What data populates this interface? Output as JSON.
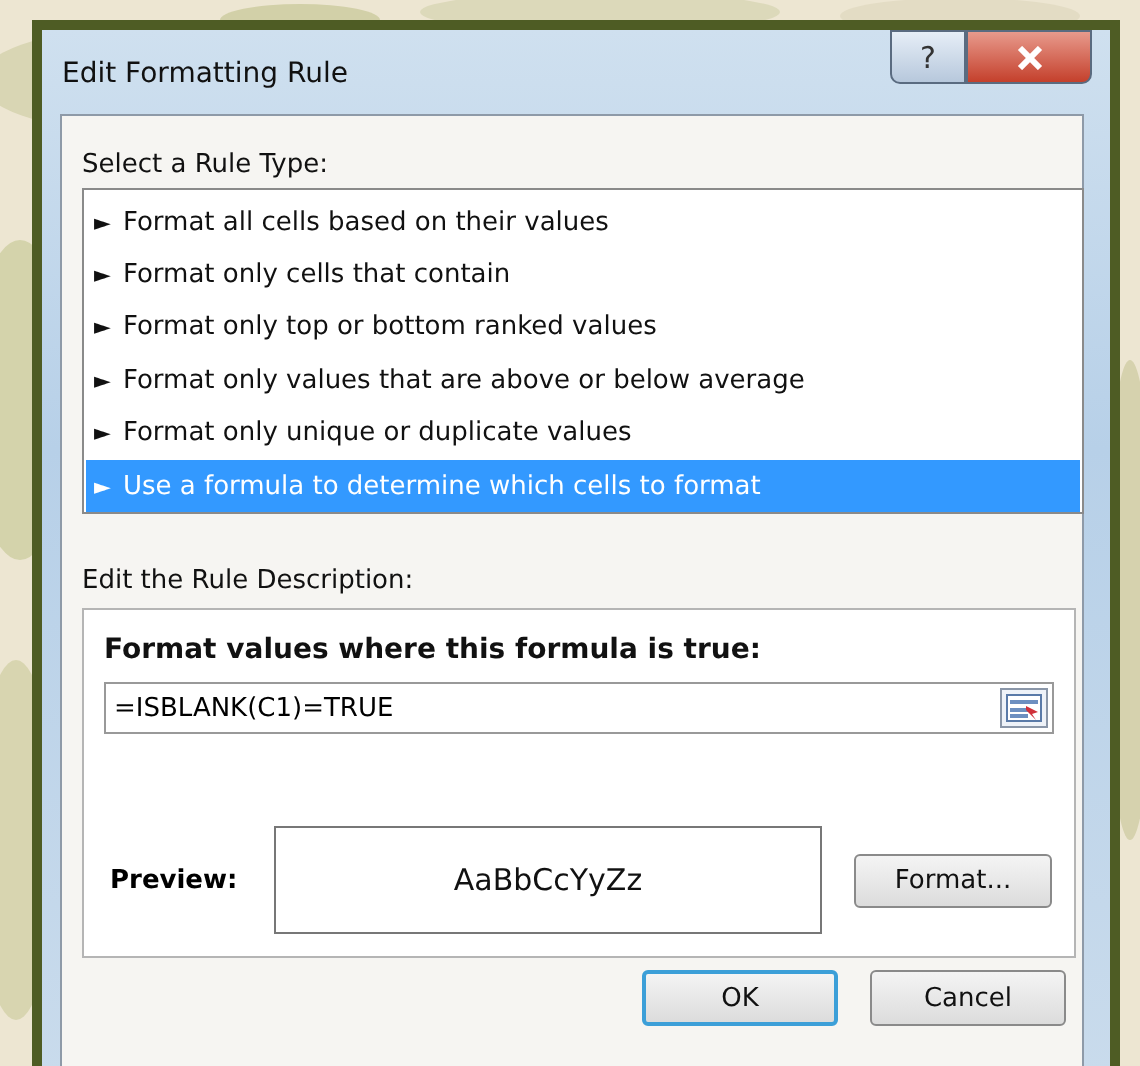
{
  "window": {
    "title": "Edit Formatting Rule",
    "help": "?"
  },
  "rule_type": {
    "label": "Select a Rule Type:",
    "items": [
      {
        "bullet": "►",
        "label": "Format all cells based on their values",
        "selected": false
      },
      {
        "bullet": "►",
        "label": "Format only cells that contain",
        "selected": false
      },
      {
        "bullet": "►",
        "label": "Format only top or bottom ranked values",
        "selected": false
      },
      {
        "bullet": "►",
        "label": "Format only values that are above or below average",
        "selected": false
      },
      {
        "bullet": "►",
        "label": "Format only unique or duplicate values",
        "selected": false
      },
      {
        "bullet": "►",
        "label": "Use a formula to determine which cells to format",
        "selected": true
      }
    ]
  },
  "description": {
    "label": "Edit the Rule Description:",
    "heading": "Format values where this formula is true:",
    "formula": "=ISBLANK(C1)=TRUE",
    "preview_label": "Preview:",
    "preview_text": "AaBbCcYyZz",
    "format_button": "Format..."
  },
  "buttons": [
    {
      "label": "OK",
      "default": true
    },
    {
      "label": "Cancel",
      "default": false
    }
  ]
}
